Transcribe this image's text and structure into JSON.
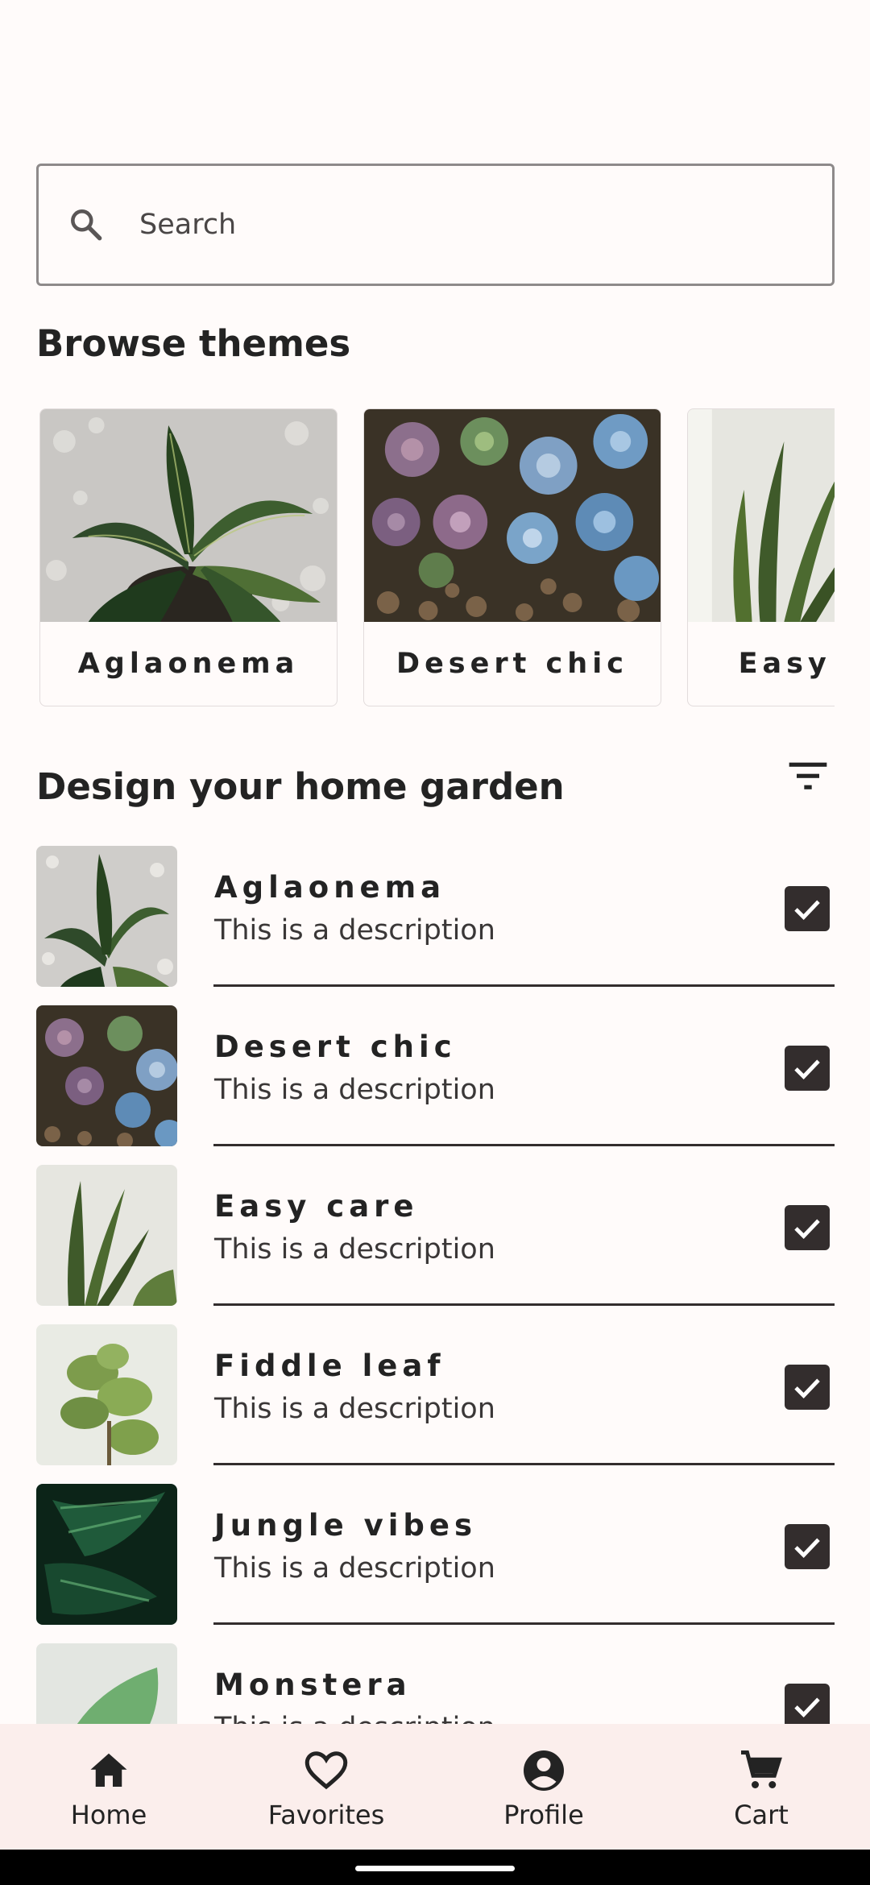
{
  "search": {
    "placeholder": "Search"
  },
  "browse": {
    "title": "Browse themes",
    "themes": [
      {
        "label": "Aglaonema"
      },
      {
        "label": "Desert chic"
      },
      {
        "label": "Easy care"
      }
    ]
  },
  "design": {
    "title": "Design your home garden",
    "items": [
      {
        "name": "Aglaonema",
        "description": "This is a description",
        "checked": true
      },
      {
        "name": "Desert chic",
        "description": "This is a description",
        "checked": true
      },
      {
        "name": "Easy care",
        "description": "This is a description",
        "checked": true
      },
      {
        "name": "Fiddle leaf",
        "description": "This is a description",
        "checked": true
      },
      {
        "name": "Jungle vibes",
        "description": "This is a description",
        "checked": true
      },
      {
        "name": "Monstera",
        "description": "This is a description",
        "checked": true
      }
    ]
  },
  "nav": {
    "items": [
      {
        "label": "Home",
        "icon": "home-icon"
      },
      {
        "label": "Favorites",
        "icon": "heart-icon"
      },
      {
        "label": "Profile",
        "icon": "account-icon"
      },
      {
        "label": "Cart",
        "icon": "cart-icon"
      }
    ]
  },
  "colors": {
    "background": "#FFFBFA",
    "primary": "#332D2D",
    "nav": "#FBEEEC"
  }
}
